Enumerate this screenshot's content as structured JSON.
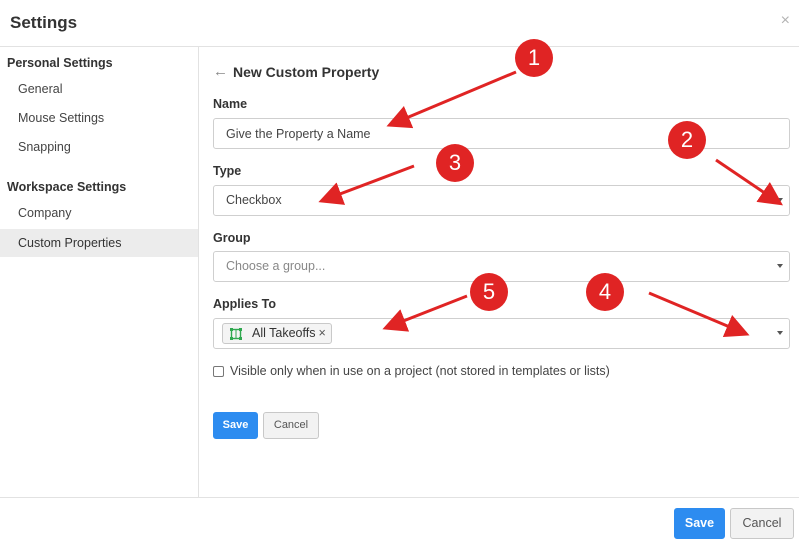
{
  "dialog": {
    "title": "Settings",
    "close_glyph": "×"
  },
  "sidebar": {
    "sections": [
      {
        "title": "Personal Settings",
        "items": [
          "General",
          "Mouse Settings",
          "Snapping"
        ]
      },
      {
        "title": "Workspace Settings",
        "items": [
          "Company",
          "Custom Properties"
        ]
      }
    ],
    "active_item": "Custom Properties"
  },
  "form": {
    "heading": "New Custom Property",
    "back_icon": "arrow-left-icon",
    "name": {
      "label": "Name",
      "value": "Give the Property a Name"
    },
    "type": {
      "label": "Type",
      "value": "Checkbox"
    },
    "group": {
      "label": "Group",
      "placeholder": "Choose a group..."
    },
    "applies_to": {
      "label": "Applies To",
      "tag": "All Takeoffs",
      "tag_remove": "×",
      "tag_icon": "takeoff-grid-icon"
    },
    "visible_checkbox": {
      "label": "Visible only when in use on a project (not stored in templates or lists)",
      "checked": false
    },
    "save_label": "Save",
    "cancel_label": "Cancel"
  },
  "footer": {
    "save_label": "Save",
    "cancel_label": "Cancel"
  },
  "annotations": [
    "1",
    "2",
    "3",
    "4",
    "5"
  ],
  "colors": {
    "primary": "#2d8cf0",
    "annotation": "#e02424",
    "active_bg": "#ececec"
  }
}
